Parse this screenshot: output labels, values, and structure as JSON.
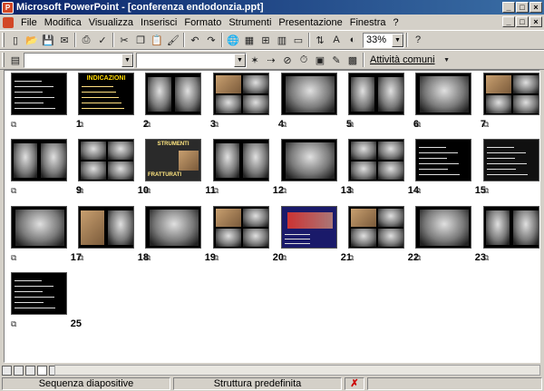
{
  "window": {
    "title": "Microsoft PowerPoint - [conferenza endodonzia.ppt]",
    "app_icon": "powerpoint-icon"
  },
  "menu": {
    "items": [
      "File",
      "Modifica",
      "Visualizza",
      "Inserisci",
      "Formato",
      "Strumenti",
      "Presentazione",
      "Finestra",
      "?"
    ]
  },
  "toolbar": {
    "zoom_value": "33%",
    "font_box": "",
    "size_box": "",
    "tasks_label": "Attività comuni"
  },
  "slides": [
    {
      "number": "1"
    },
    {
      "number": "2"
    },
    {
      "number": "3"
    },
    {
      "number": "4"
    },
    {
      "number": "5"
    },
    {
      "number": "6"
    },
    {
      "number": "7"
    },
    {
      "number": "8"
    },
    {
      "number": "9"
    },
    {
      "number": "10"
    },
    {
      "number": "11"
    },
    {
      "number": "12"
    },
    {
      "number": "13"
    },
    {
      "number": "14"
    },
    {
      "number": "15"
    },
    {
      "number": "16"
    },
    {
      "number": "17"
    },
    {
      "number": "18"
    },
    {
      "number": "19"
    },
    {
      "number": "20"
    },
    {
      "number": "21"
    },
    {
      "number": "22"
    },
    {
      "number": "23"
    },
    {
      "number": "24"
    },
    {
      "number": "25"
    }
  ],
  "slide_titles": {
    "s2": "INDICAZIONI",
    "s11a": "STRUMENTI",
    "s11b": "FRATTURATI"
  },
  "status": {
    "view": "Sequenza diapositive",
    "design": "Struttura predefinita"
  }
}
